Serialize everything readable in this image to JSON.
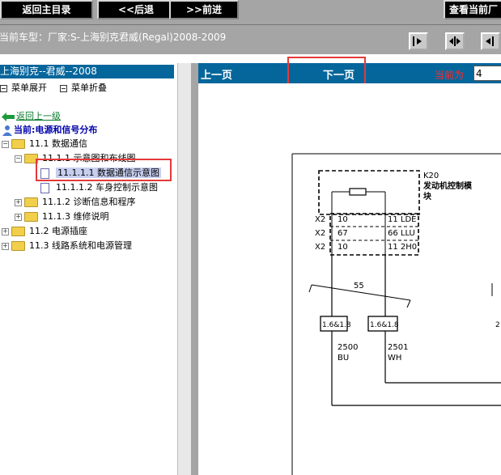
{
  "toolbar": {
    "return_main": "返回主目录",
    "back": "<<后退",
    "forward": ">>前进",
    "view_current": "查看当前厂"
  },
  "vehicle": {
    "current_model": "当前车型：厂家:S-上海别克君威(Regal)2008-2009"
  },
  "tree": {
    "header": "上海别克--君威--2008",
    "expand_menu": "菜单展开",
    "collapse_menu": "菜单折叠",
    "back_up": "返回上一级",
    "current_location": "当前:电源和信号分布",
    "nodes": [
      {
        "label": "11.1 数据通信"
      },
      {
        "label": "11.1.1 示意图和布线图"
      },
      {
        "label": "11.1.1.1 数据通信示意图"
      },
      {
        "label": "11.1.1.2 车身控制示意图"
      },
      {
        "label": "11.1.2 诊断信息和程序"
      },
      {
        "label": "11.1.3 维修说明"
      },
      {
        "label": "11.2 电源插座"
      },
      {
        "label": "11.3 线路系统和电源管理"
      }
    ]
  },
  "content_nav": {
    "prev_page": "上一页",
    "next_page": "下一页",
    "current_label": "当前为",
    "page_value": "4"
  },
  "diagram": {
    "module_id": "K20",
    "module_name_line1": "发动机控制模",
    "module_name_line2": "块",
    "rows": [
      {
        "connector": "X2",
        "pin_left": "10",
        "pin_right": "11 LDE"
      },
      {
        "connector": "X2",
        "pin_left": "67",
        "pin_right": "66 LLU"
      },
      {
        "connector": "X2",
        "pin_left": "10",
        "pin_right": "11 2H0"
      }
    ],
    "splice_label": "55",
    "fuse_left": "1.6&1.8",
    "fuse_right": "1.6&1.8",
    "fuse_far_right": "2",
    "wire_left_num": "2500",
    "wire_left_color": "BU",
    "wire_right_num": "2501",
    "wire_right_color": "WH"
  }
}
